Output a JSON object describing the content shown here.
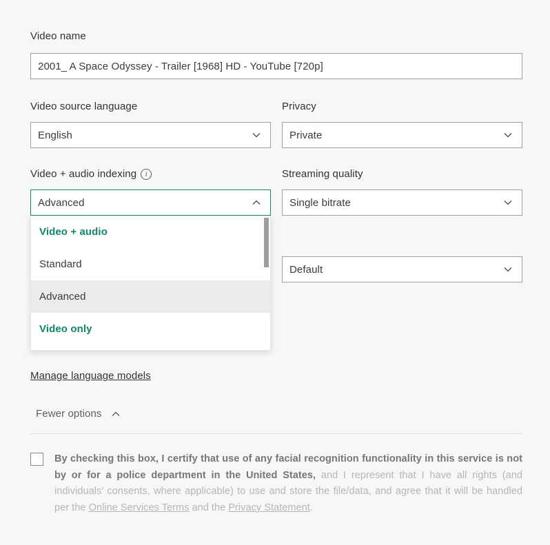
{
  "form": {
    "video_name": {
      "label": "Video name",
      "value": "2001_  A Space Odyssey - Trailer [1968] HD - YouTube [720p]",
      "placeholder": "Video name"
    },
    "source_language": {
      "label": "Video source language",
      "value": "English"
    },
    "privacy": {
      "label": "Privacy",
      "value": "Private"
    },
    "indexing": {
      "label": "Video + audio indexing",
      "info_icon": "info-icon",
      "value": "Advanced",
      "expanded": true,
      "options": [
        {
          "label": "Video + audio",
          "type": "header",
          "selected": false
        },
        {
          "label": "Standard",
          "type": "item",
          "selected": false
        },
        {
          "label": "Advanced",
          "type": "item",
          "selected": true
        },
        {
          "label": "Video only",
          "type": "header",
          "selected": false
        }
      ]
    },
    "streaming_quality": {
      "label": "Streaming quality",
      "value": "Single bitrate"
    },
    "encoding_preset": {
      "value": "Default"
    },
    "manage_language_models_link": "Manage language models",
    "fewer_options": {
      "label": "Fewer options",
      "icon": "chevron-up-icon"
    }
  },
  "consent": {
    "part_bold": "By checking this box, I certify that use of any facial recognition functionality in this service is not by or for a police department in the United States,",
    "part_rest_1": " and I represent that I have all rights (and individuals’ consents, where applicable) to use and store the file/data, and agree that it will be handled per the ",
    "link_terms": "Online Services Terms",
    "part_rest_2": " and the ",
    "link_privacy": "Privacy Statement",
    "part_end": "."
  },
  "colors": {
    "accent_teal": "#12866b",
    "background": "#f7f7f7",
    "border": "#a19f9d",
    "selected_row": "#ebebeb",
    "muted_text": "#b6b6b6"
  }
}
